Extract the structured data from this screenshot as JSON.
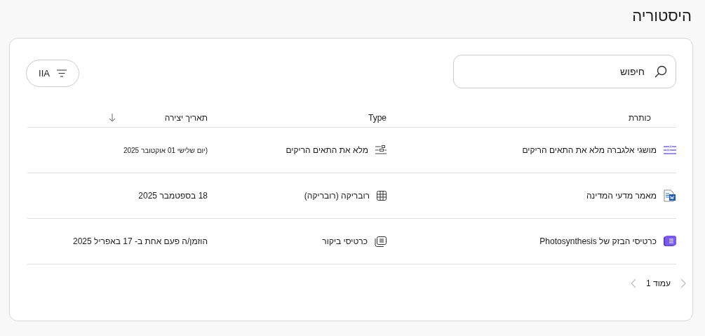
{
  "page_title": "היסטוריה",
  "search": {
    "placeholder": "חיפוש"
  },
  "filter_button": {
    "label": "IIA"
  },
  "table": {
    "columns": [
      {
        "label": "כותרת",
        "sorted": false
      },
      {
        "label": "Type",
        "sorted": false
      },
      {
        "label": "תאריך יצירה",
        "sorted": true
      }
    ],
    "rows": [
      {
        "title": {
          "text": "מושגי אלגברה מלא את התאים הריקים",
          "kind": "fill-blanks"
        },
        "type": {
          "text": "מלא את התאים הריקים",
          "kind": "fill-blanks"
        },
        "date": "(יום שלישי 01 אוקטובר 2025",
        "date_small": true
      },
      {
        "title": {
          "text": "מאמר מדעי המדינה",
          "kind": "document"
        },
        "type": {
          "text": "רובריקה (רובריקה)",
          "kind": "grid"
        },
        "date": "18 בספטמבר 2025",
        "date_small": false
      },
      {
        "title": {
          "text": "כרטיסי הבזק של Photosynthesis",
          "kind": "flashcards"
        },
        "type": {
          "text": "כרטיסי ביקור",
          "kind": "flashcards"
        },
        "date": "הוזמן/ה פעם אחת ב- 17 באפריל 2025",
        "date_small": false
      }
    ]
  },
  "pagination": {
    "label": "עמוד 1",
    "previous_disabled": true,
    "next_disabled": true
  }
}
